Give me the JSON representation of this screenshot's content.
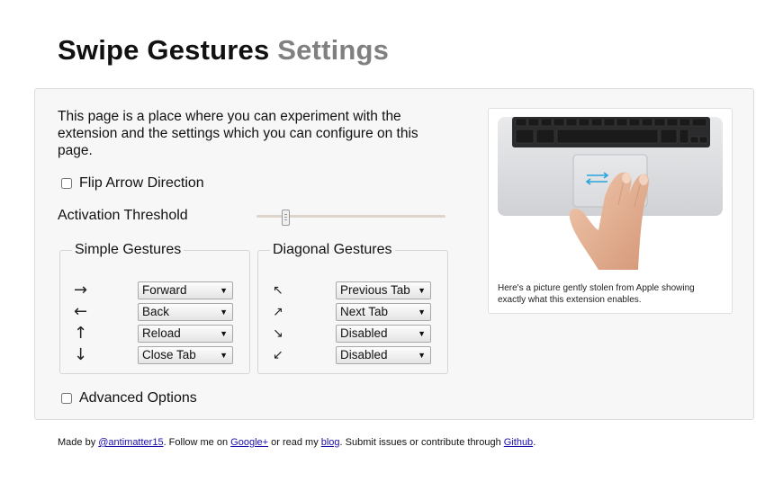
{
  "header": {
    "title_main": "Swipe Gestures",
    "title_accent": "Settings"
  },
  "intro": "This page is a place where you can experiment with the extension and the settings which you can configure on this page.",
  "options": {
    "flip_arrow_label": "Flip Arrow Direction",
    "flip_arrow_checked": false,
    "advanced_label": "Advanced Options",
    "advanced_checked": false
  },
  "threshold": {
    "label": "Activation Threshold",
    "value_fraction": 0.15
  },
  "simple_gestures": {
    "legend": "Simple Gestures",
    "rows": [
      {
        "arrow": "→",
        "arrow_icon": "arrow-right-icon",
        "value": "Forward"
      },
      {
        "arrow": "←",
        "arrow_icon": "arrow-left-icon",
        "value": "Back"
      },
      {
        "arrow": "↑",
        "arrow_icon": "arrow-up-icon",
        "value": "Reload"
      },
      {
        "arrow": "↓",
        "arrow_icon": "arrow-down-icon",
        "value": "Close Tab"
      }
    ]
  },
  "diagonal_gestures": {
    "legend": "Diagonal Gestures",
    "rows": [
      {
        "arrow": "↖",
        "arrow_icon": "arrow-up-left-icon",
        "value": "Previous Tab"
      },
      {
        "arrow": "↗",
        "arrow_icon": "arrow-up-right-icon",
        "value": "Next Tab"
      },
      {
        "arrow": "↘",
        "arrow_icon": "arrow-down-right-icon",
        "value": "Disabled"
      },
      {
        "arrow": "↙",
        "arrow_icon": "arrow-down-left-icon",
        "value": "Disabled"
      }
    ]
  },
  "figure": {
    "caption": "Here's a picture gently stolen from Apple showing exactly what this extension enables."
  },
  "footer": {
    "t1": "Made by ",
    "link_author": "@antimatter15",
    "t2": ". Follow me on ",
    "link_gplus": "Google+",
    "t3": " or read my ",
    "link_blog": "blog",
    "t4": ". Submit issues or contribute through ",
    "link_github": "Github",
    "t5": "."
  },
  "colors": {
    "title_accent": "#808080",
    "panel_bg": "#f7f7f7",
    "link": "#1a0dab",
    "trackpad_arrows": "#2aa4dc"
  }
}
